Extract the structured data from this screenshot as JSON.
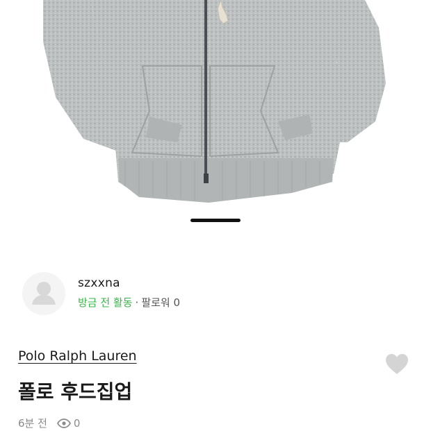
{
  "product_image": {
    "icon": "gray-zip-hoodie-photo"
  },
  "carousel": {
    "active_index": 1
  },
  "seller": {
    "avatar_icon": "default-avatar-icon",
    "name": "szxxna",
    "activity": "방금 전 활동",
    "separator": "·",
    "followers_label": "팔로워",
    "followers_count": "0"
  },
  "product": {
    "brand": "Polo Ralph Lauren",
    "title": "폴로 후드집업",
    "posted_time": "6분 전",
    "view_icon": "eye-icon",
    "views": "0",
    "like_icon": "heart-icon"
  },
  "colors": {
    "activity_green": "#39b54a",
    "hoodie_gray": "#b9bcbc",
    "heart_gray": "#d4d4d4"
  }
}
